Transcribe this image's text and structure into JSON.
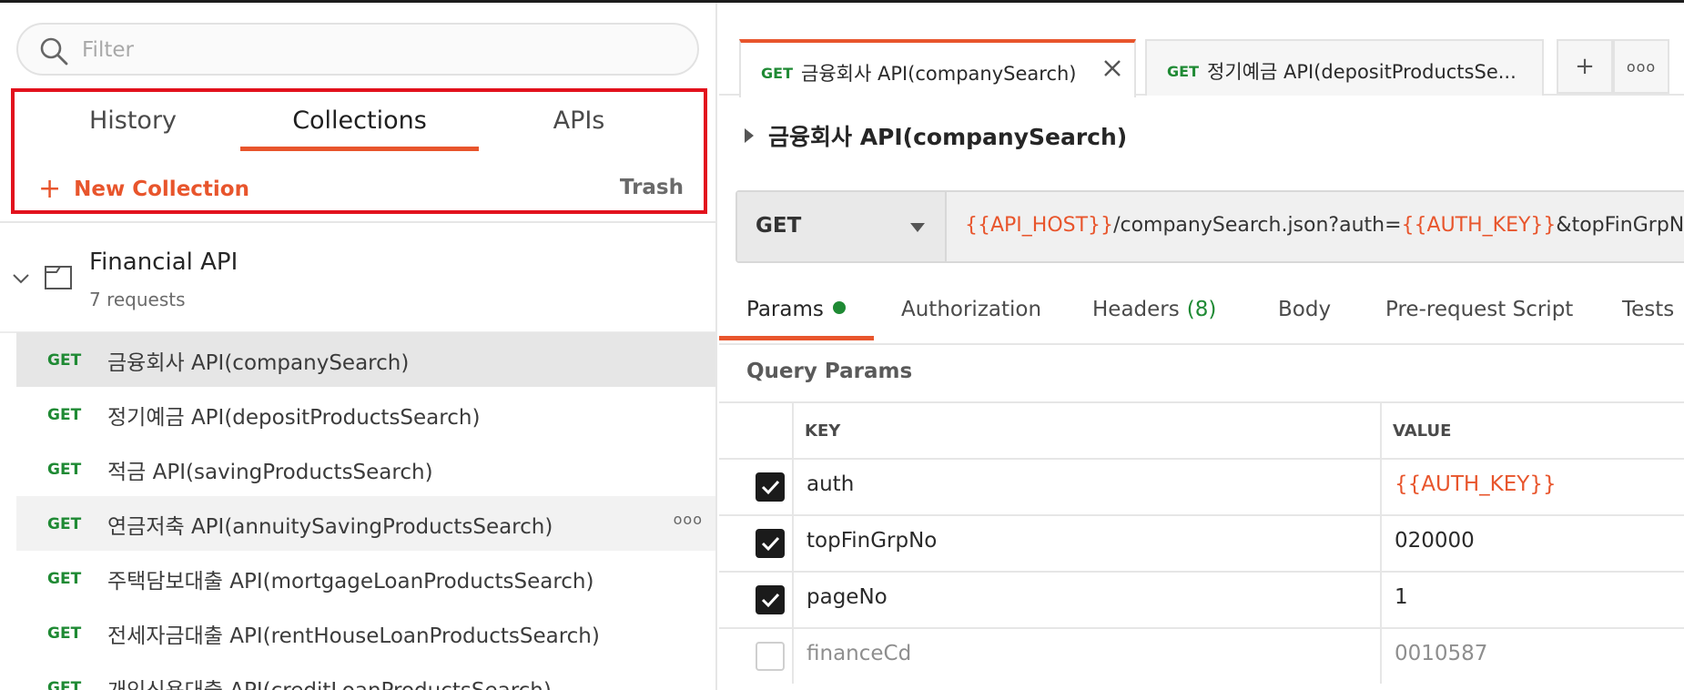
{
  "sidebar": {
    "filter_placeholder": "Filter",
    "tabs": [
      {
        "label": "History"
      },
      {
        "label": "Collections"
      },
      {
        "label": "APIs"
      }
    ],
    "active_tab": "Collections",
    "new_collection_label": "New Collection",
    "trash_label": "Trash",
    "collection": {
      "name": "Financial API",
      "count": "7 requests"
    },
    "requests": [
      {
        "method": "GET",
        "name": "금융회사 API(companySearch)",
        "state": "selected"
      },
      {
        "method": "GET",
        "name": "정기예금 API(depositProductsSearch)",
        "state": ""
      },
      {
        "method": "GET",
        "name": "적금 API(savingProductsSearch)",
        "state": ""
      },
      {
        "method": "GET",
        "name": "연금저축 API(annuitySavingProductsSearch)",
        "state": "hover",
        "more": "ooo"
      },
      {
        "method": "GET",
        "name": "주택담보대출 API(mortgageLoanProductsSearch)",
        "state": ""
      },
      {
        "method": "GET",
        "name": "전세자금대출 API(rentHouseLoanProductsSearch)",
        "state": ""
      },
      {
        "method": "GET",
        "name": "개인신용대출 API(creditLoanProductsSearch)",
        "state": ""
      }
    ]
  },
  "main": {
    "tabs": [
      {
        "method": "GET",
        "name": "금융회사 API(companySearch)",
        "active": true
      },
      {
        "method": "GET",
        "name": "정기예금 API(depositProductsSe...",
        "active": false
      }
    ],
    "new_tab_label": "+",
    "tab_options_label": "ooo",
    "request_title": "금융회사 API(companySearch)",
    "method": "GET",
    "url": {
      "var1": "{{API_HOST}}",
      "path": "/companySearch.json?auth=",
      "var2": "{{AUTH_KEY}}",
      "rest": "&topFinGrpNo="
    },
    "param_tabs": {
      "params": "Params",
      "authorization": "Authorization",
      "headers": "Headers",
      "headers_count": "(8)",
      "body": "Body",
      "prerequest": "Pre-request Script",
      "tests": "Tests"
    },
    "query_params_title": "Query Params",
    "columns": {
      "key": "KEY",
      "value": "VALUE"
    },
    "params": [
      {
        "checked": true,
        "key": "auth",
        "value": "{{AUTH_KEY}}"
      },
      {
        "checked": true,
        "key": "topFinGrpNo",
        "value": "020000"
      },
      {
        "checked": true,
        "key": "pageNo",
        "value": "1"
      },
      {
        "checked": false,
        "key": "financeCd",
        "value": "0010587"
      }
    ]
  },
  "colors": {
    "accent": "#e8552c",
    "get_method": "#1f8a34",
    "highlight_box": "#e2121d"
  }
}
